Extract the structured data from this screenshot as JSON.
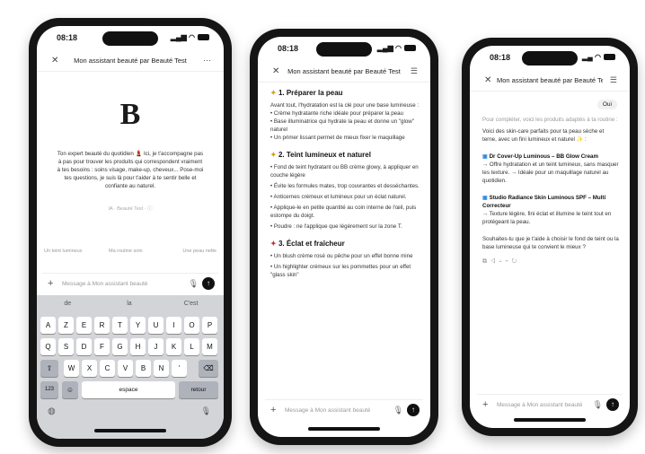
{
  "phone1": {
    "time": "08:18",
    "title": "Mon assistant beauté par Beauté Test",
    "logo": "B",
    "intro": "Ton expert beauté du quotidien 💄 Ici, je t'accompagne pas à pas pour trouver les produits qui correspondent vraiment à tes besoins : soins visage, make-up, cheveux... Pose-moi tes questions, je suis là pour t'aider à te sentir belle et confiante au naturel.",
    "disclaimer": "IA · Beauté Test · ⓘ",
    "suggestions": [
      "Un teint lumineux",
      "Ma routine soin",
      "Une peau nette"
    ],
    "input_placeholder": "Message à Mon assistant beauté",
    "keyboard": {
      "suggestions": [
        "de",
        "la",
        "C'est"
      ],
      "row1": [
        "A",
        "Z",
        "E",
        "R",
        "T",
        "Y",
        "U",
        "I",
        "O",
        "P"
      ],
      "row2": [
        "Q",
        "S",
        "D",
        "F",
        "G",
        "H",
        "J",
        "K",
        "L",
        "M"
      ],
      "row3": [
        "W",
        "X",
        "C",
        "V",
        "B",
        "N",
        "'"
      ],
      "space": "espace",
      "return": "retour",
      "numbers": "123"
    }
  },
  "phone2": {
    "time": "08:18",
    "title": "Mon assistant beauté par Beauté Test",
    "sections": [
      {
        "heading": "1. Préparer la peau",
        "paras": [
          "Avant tout, l'hydratation est la clé pour une base lumineuse :",
          "• Crème hydratante riche idéale pour préparer la peau",
          "• Base illuminatrice qui hydrate la peau et donne un \"glow\" naturel",
          "• Un primer lissant permet de mieux fixer le maquillage"
        ]
      },
      {
        "heading": "2. Teint lumineux et naturel",
        "paras": [
          "• Fond de teint hydratant ou BB crème glowy, à appliquer en couche légère",
          "• Évite les formules mates, trop couvrantes et desséchantes.",
          "• Anticernes crémeux et lumineux pour un éclat naturel.",
          "• Applique-le en petite quantité au coin interne de l'œil, puis estompe du doigt.",
          "• Poudre : ne l'applique que légèrement sur la zone T."
        ]
      },
      {
        "heading": "3. Éclat et fraîcheur",
        "paras": [
          "• Un blush crème rosé ou pêche pour un effet bonne mine",
          "• Un highlighter crémeux sur les pommettes pour un effet \"glass skin\""
        ]
      }
    ],
    "input_placeholder": "Message à Mon assistant beauté"
  },
  "phone3": {
    "time": "08:18",
    "title": "Mon assistant beauté par Beauté Test",
    "user_msg": "Oui",
    "paras": [
      "Pour compléter, voici les produits adaptés à ta routine :",
      "Voici des skin-care parfaits pour ta peau sèche et terne, avec un fini lumineux et naturel ✨ :"
    ],
    "products": [
      {
        "name": "Dr Cover-Up Luminous – BB Glow Cream",
        "desc": "→ Offre hydratation et un teint lumineux, sans masquer les texture. → Idéale pour un maquillage naturel au quotidien."
      },
      {
        "name": "Studio Radiance Skin Luminous SPF – Multi Correcteur",
        "desc": "→ Texture légère, fini éclat et illumine le teint tout en protégeant la peau."
      }
    ],
    "question": "Souhaites-tu que je t'aide à choisir le fond de teint ou la base lumineuse qui te convient le mieux ?",
    "input_placeholder": "Message à Mon assistant beauté"
  },
  "colors": {
    "frame": "#151515",
    "send": "#111111",
    "keyboard": "#d2d4d8"
  }
}
